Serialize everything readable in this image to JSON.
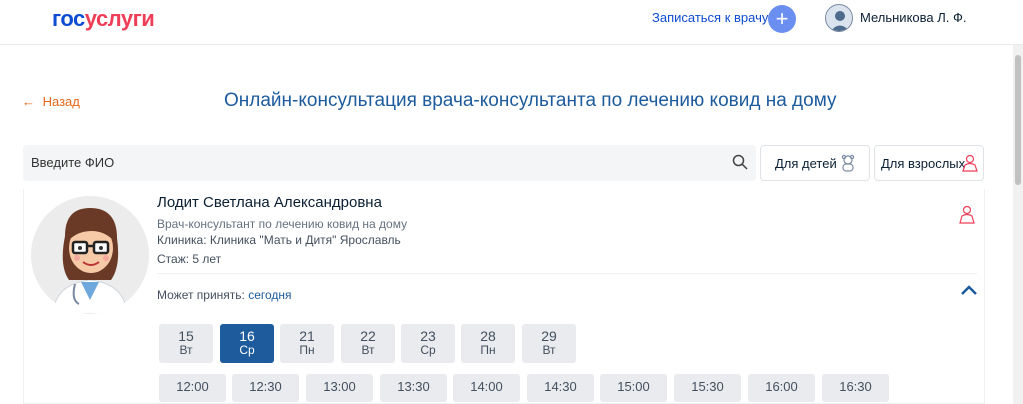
{
  "header": {
    "logo_part1": "гос",
    "logo_part2": "услуги",
    "signup_label": "Записаться к врачу",
    "plus_symbol": "+",
    "user_name": "Мельникова Л. Ф."
  },
  "nav": {
    "back_label": "Назад"
  },
  "page_title": "Онлайн-консультация врача-консультанта по лечению ковид на дому",
  "search": {
    "placeholder": "Введите ФИО",
    "icon": "search-icon"
  },
  "filters": [
    {
      "label": "Для детей",
      "icon": "baby-icon"
    },
    {
      "label": "Для взрослых",
      "icon": "adult-icon"
    }
  ],
  "doctor": {
    "name": "Лодит Светлана Александровна",
    "role": "Врач-консультант по лечению ковид на дому",
    "clinic": "Клиника: Клиника \"Мать и Дитя\" Ярославль",
    "experience": "Стаж: 5 лет",
    "accept_label": "Может принять:",
    "accept_value": "сегодня"
  },
  "days": [
    {
      "num": "15",
      "wd": "Вт",
      "selected": false
    },
    {
      "num": "16",
      "wd": "Ср",
      "selected": true
    },
    {
      "num": "21",
      "wd": "Пн",
      "selected": false
    },
    {
      "num": "22",
      "wd": "Вт",
      "selected": false
    },
    {
      "num": "23",
      "wd": "Ср",
      "selected": false
    },
    {
      "num": "28",
      "wd": "Пн",
      "selected": false
    },
    {
      "num": "29",
      "wd": "Вт",
      "selected": false
    }
  ],
  "times": [
    "12:00",
    "12:30",
    "13:00",
    "13:30",
    "14:00",
    "14:30",
    "15:00",
    "15:30",
    "16:00",
    "16:30"
  ],
  "colors": {
    "brand_blue": "#0d4cd3",
    "brand_red": "#ee3f58",
    "title_blue": "#1d5b9c",
    "back_orange": "#e8671b"
  }
}
